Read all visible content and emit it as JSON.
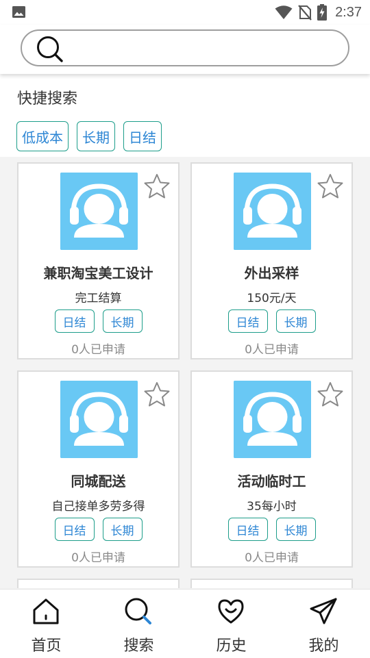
{
  "status_bar": {
    "time": "2:37",
    "icons": [
      "image-icon",
      "wifi-icon",
      "no-sim-icon",
      "battery-charging-icon"
    ]
  },
  "search": {
    "placeholder": "",
    "icon": "search-icon"
  },
  "quick_search": {
    "title": "快捷搜索",
    "tags": [
      "低成本",
      "长期",
      "日结"
    ]
  },
  "jobs": [
    {
      "title": "兼职淘宝美工设计",
      "salary": "完工结算",
      "tags": [
        "日结",
        "长期"
      ],
      "applied": "0人已申请"
    },
    {
      "title": "外出采样",
      "salary": "150元/天",
      "tags": [
        "日结",
        "长期"
      ],
      "applied": "0人已申请"
    },
    {
      "title": "同城配送",
      "salary": "自己接单多劳多得",
      "tags": [
        "日结",
        "长期"
      ],
      "applied": "0人已申请"
    },
    {
      "title": "活动临时工",
      "salary": "35每小时",
      "tags": [
        "日结",
        "长期"
      ],
      "applied": "0人已申请"
    }
  ],
  "bottom_nav": [
    {
      "label": "首页",
      "icon": "home-icon",
      "active": false
    },
    {
      "label": "搜索",
      "icon": "search-icon",
      "active": true
    },
    {
      "label": "历史",
      "icon": "heart-icon",
      "active": false
    },
    {
      "label": "我的",
      "icon": "send-icon",
      "active": false
    }
  ],
  "colors": {
    "accent_blue": "#2d86d4",
    "tag_border": "#1c9d8a",
    "avatar_bg": "#69c8f4"
  }
}
